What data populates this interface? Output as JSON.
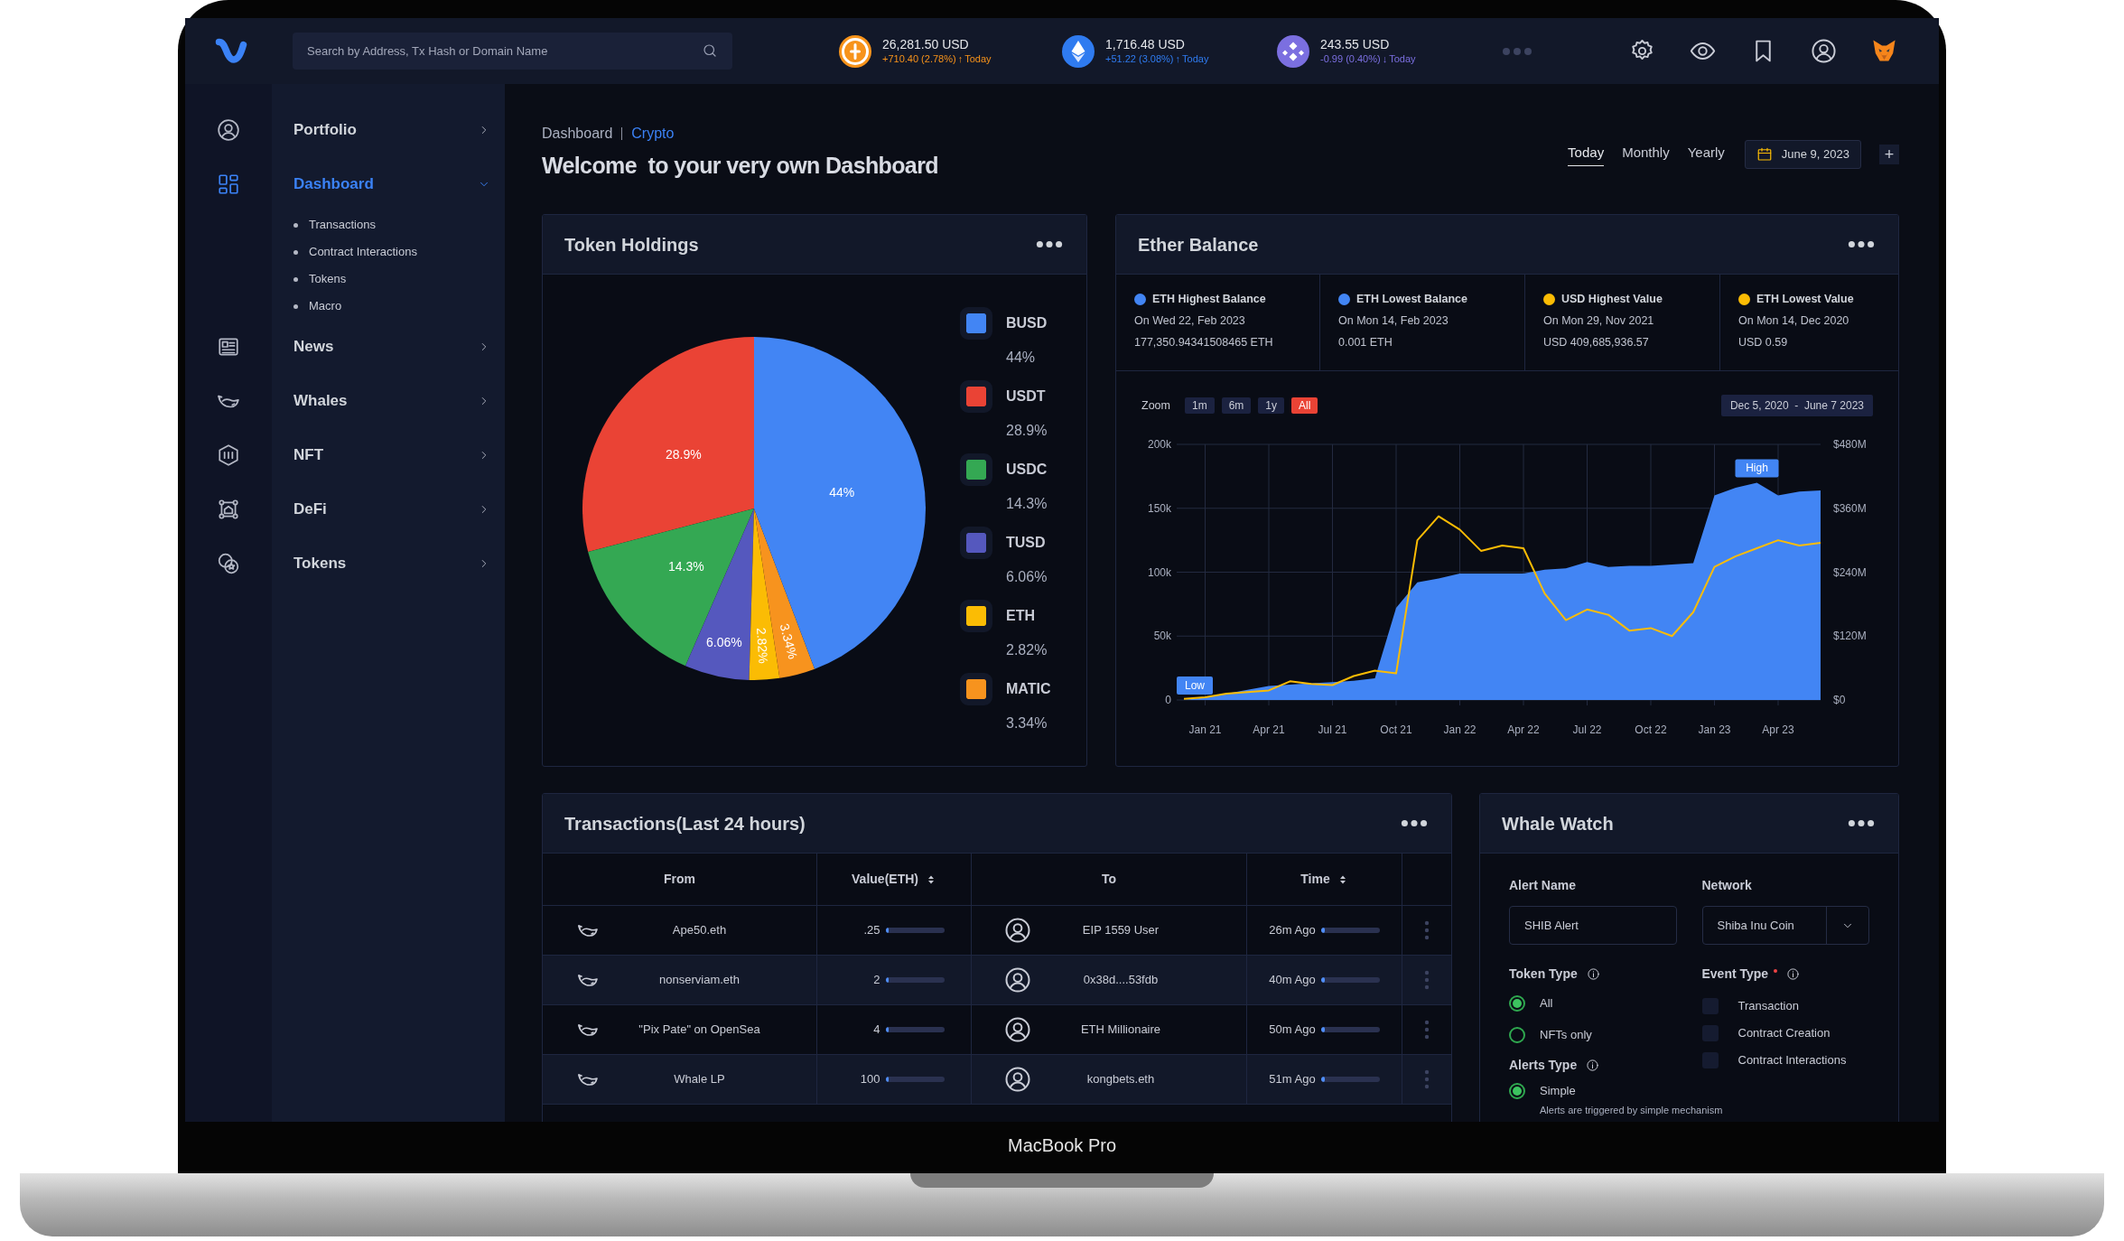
{
  "top_bar": {
    "search": {
      "placeholder": "Search by Address, Tx Hash or Domain Name"
    },
    "tickers": [
      {
        "price": "26,281.50 USD",
        "change": "+710.40 (2.78%)",
        "arrow": "↑",
        "period": "Today",
        "color": "#f7931a"
      },
      {
        "price": "1,716.48 USD",
        "change": "+51.22 (3.08%)",
        "arrow": "↑",
        "period": "Today",
        "color": "#2f7bf0"
      },
      {
        "price": "243.55 USD",
        "change": "-0.99 (0.40%)",
        "arrow": "↓",
        "period": "Today",
        "color": "#7b6fe0"
      }
    ]
  },
  "sidebar": {
    "items": [
      {
        "label": "Portfolio",
        "selected": false,
        "expanded": false
      },
      {
        "label": "Dashboard",
        "selected": true,
        "expanded": true,
        "children": [
          {
            "label": "Transactions"
          },
          {
            "label": "Contract Interactions"
          },
          {
            "label": "Tokens"
          },
          {
            "label": "Macro"
          }
        ]
      },
      {
        "label": "News",
        "selected": false,
        "expanded": false
      },
      {
        "label": "Whales",
        "selected": false,
        "expanded": false
      },
      {
        "label": "NFT",
        "selected": false,
        "expanded": false
      },
      {
        "label": "DeFi",
        "selected": false,
        "expanded": false
      },
      {
        "label": "Tokens",
        "selected": false,
        "expanded": false
      }
    ]
  },
  "breadcrumb": [
    {
      "label": "Dashboard",
      "selected": false
    },
    {
      "label": "Crypto",
      "selected": true
    }
  ],
  "page_title": "Welcome  to your very own Dashboard",
  "period_tabs": [
    {
      "label": "Today",
      "selected": true
    },
    {
      "label": "Monthly",
      "selected": false
    },
    {
      "label": "Yearly",
      "selected": false
    }
  ],
  "date_picker": "June 9, 2023",
  "add_button": "+",
  "token_holdings": {
    "title": "Token Holdings",
    "chart_data": {
      "type": "pie",
      "categories": [
        "BUSD",
        "USDT",
        "USDC",
        "TUSD",
        "ETH",
        "MATIC"
      ],
      "values": [
        44,
        28.9,
        14.3,
        6.06,
        2.82,
        3.34
      ],
      "colors": [
        "#4285f4",
        "#ea4335",
        "#34a853",
        "#5558be",
        "#fbbc04",
        "#f7931e"
      ],
      "data_labels": true,
      "value_labels": [
        "44%",
        "28.9%",
        "14.3%",
        "6.06%",
        "2.82%",
        "3.34%"
      ]
    },
    "legend": [
      {
        "value": "44%",
        "color": "#4285f4"
      },
      {
        "value": "28.9%",
        "color": "#ea4335"
      },
      {
        "value": "14.3%",
        "color": "#34a853"
      },
      {
        "value": "6.06%",
        "color": "#5558be"
      },
      {
        "value": "2.82%",
        "color": "#fbbc04"
      },
      {
        "value": "3.34%",
        "color": "#f7931e"
      }
    ]
  },
  "ether_balance": {
    "title": "Ether Balance",
    "stats": [
      {
        "title": "ETH Highest Balance",
        "date": "On Wed 22, Feb 2023",
        "value": "177,350.94341508465 ETH",
        "color": "#4285f4"
      },
      {
        "title": "ETH Lowest Balance",
        "date": "On Mon 14, Feb 2023",
        "value": "0.001 ETH",
        "color": "#4285f4"
      },
      {
        "title": "USD Highest Value",
        "date": "On Mon 29, Nov 2021",
        "value": "USD 409,685,936.57",
        "color": "#fbbc04"
      },
      {
        "title": "ETH Lowest Value",
        "date": "On Mon 14, Dec 2020",
        "value": "USD 0.59",
        "color": "#fbbc04"
      }
    ],
    "zoom": {
      "label": "Zoom",
      "options": [
        {
          "label": "1m",
          "selected": false
        },
        {
          "label": "6m",
          "selected": false
        },
        {
          "label": "1y",
          "selected": false
        },
        {
          "label": "All",
          "selected": true
        }
      ]
    },
    "date_range": "Dec 5, 2020  -  June 7 2023",
    "chart_data": {
      "type": "area",
      "categories": [
        null,
        "Jan 21",
        null,
        null,
        "Apr 21",
        null,
        null,
        "Jul 21",
        null,
        null,
        "Oct 21",
        null,
        null,
        "Jan 22",
        null,
        null,
        "Apr 22",
        null,
        null,
        "Jul 22",
        null,
        null,
        "Oct 22",
        null,
        null,
        "Jan 23",
        null,
        null,
        "Apr 23",
        null,
        null
      ],
      "series": [
        {
          "color": "#4285f4",
          "type": "area",
          "values": [
            0,
            2,
            5,
            8,
            11,
            12,
            13,
            14,
            15,
            17,
            72,
            92,
            95,
            99,
            99,
            99,
            99,
            102,
            103,
            108,
            104,
            105,
            105,
            106,
            107,
            160,
            166,
            170,
            160,
            163,
            164
          ]
        },
        {
          "color": "#fbbc04",
          "type": "line",
          "axis": "y2",
          "values": [
            2,
            5,
            12,
            15,
            18,
            35,
            30,
            28,
            45,
            55,
            50,
            300,
            345,
            320,
            280,
            290,
            285,
            200,
            150,
            170,
            160,
            130,
            135,
            120,
            165,
            250,
            270,
            285,
            300,
            290,
            295
          ]
        }
      ],
      "grid": true,
      "ylim": [
        0,
        200
      ],
      "y2lim": [
        0,
        480
      ],
      "yticks": [
        {
          "value": 0,
          "label": "0"
        },
        {
          "value": 50,
          "label": "50k"
        },
        {
          "value": 100,
          "label": "100k"
        },
        {
          "value": 150,
          "label": "150k"
        },
        {
          "value": 200,
          "label": "200k"
        }
      ],
      "y2ticks": [
        {
          "value": 0,
          "label": "$0"
        },
        {
          "value": 120,
          "label": "$120M"
        },
        {
          "value": 240,
          "label": "$240M"
        },
        {
          "value": 360,
          "label": "$360M"
        },
        {
          "value": 480,
          "label": "$480M"
        }
      ],
      "annotations": [
        "Low",
        "High"
      ]
    }
  },
  "transactions": {
    "title": "Transactions(Last 24 hours)",
    "columns": [
      {
        "label": "From",
        "sortable": false
      },
      {
        "label": "Value(ETH)",
        "sortable": true
      },
      {
        "label": "To",
        "sortable": false
      },
      {
        "label": "Time",
        "sortable": true
      }
    ],
    "rows": [
      {
        "from": "Ape50.eth",
        "value": ".25",
        "value_bar": {
          "level": 0.06
        },
        "to": "EIP 1559 User",
        "time": "26m Ago",
        "time_bar": {
          "level": 0.06
        }
      },
      {
        "from": "nonserviam.eth",
        "value": "2",
        "value_bar": {
          "level": 0.06
        },
        "to": "0x38d....53fdb",
        "time": "40m Ago",
        "time_bar": {
          "level": 0.06
        }
      },
      {
        "from": "\"Pix Pate\" on OpenSea",
        "value": "4",
        "value_bar": {
          "level": 0.06
        },
        "to": "ETH Millionaire",
        "time": "50m Ago",
        "time_bar": {
          "level": 0.06
        }
      },
      {
        "from": "Whale LP",
        "value": "100",
        "value_bar": {
          "level": 0.06
        },
        "to": "kongbets.eth",
        "time": "51m Ago",
        "time_bar": {
          "level": 0.06
        }
      }
    ]
  },
  "whale_watch": {
    "title": "Whale Watch",
    "alert_name": {
      "label": "Alert Name",
      "value": "SHIB Alert"
    },
    "network": {
      "label": "Network",
      "value": "Shiba Inu Coin"
    },
    "token_type": {
      "label": "Token Type",
      "options": [
        {
          "label": "All",
          "selected": true
        },
        {
          "label": "NFTs only",
          "selected": false
        }
      ]
    },
    "event_type": {
      "label": "Event Type",
      "required": true,
      "options": [
        {
          "label": "Transaction",
          "checked": false
        },
        {
          "label": "Contract Creation",
          "checked": false
        },
        {
          "label": "Contract Interactions",
          "checked": false
        }
      ]
    },
    "alerts_type": {
      "label": "Alerts Type",
      "options": [
        {
          "label": "Simple",
          "selected": true,
          "help": "Alerts are triggered by simple mechanism"
        }
      ]
    }
  },
  "device": {
    "label": "MacBook Pro"
  }
}
